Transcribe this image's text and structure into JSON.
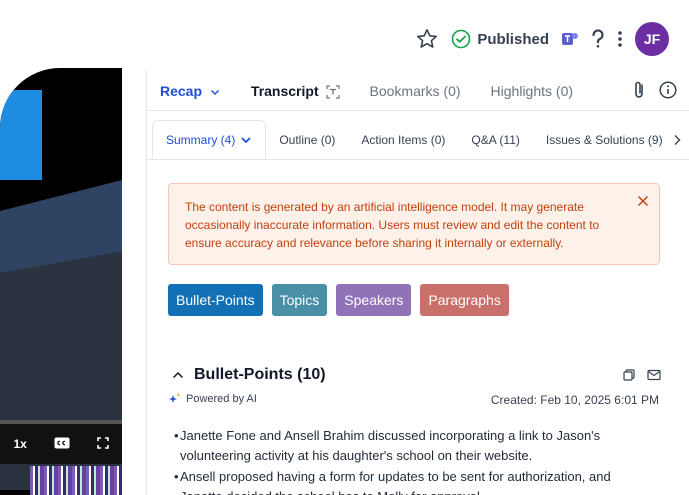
{
  "header": {
    "status_label": "Published",
    "avatar_initials": "JF"
  },
  "video": {
    "speed_label": "1x"
  },
  "top_tabs": [
    {
      "label": "Recap"
    },
    {
      "label": "Transcript"
    },
    {
      "label": "Bookmarks (0)"
    },
    {
      "label": "Highlights (0)"
    }
  ],
  "sub_tabs": [
    {
      "label": "Summary (4)"
    },
    {
      "label": "Outline (0)"
    },
    {
      "label": "Action Items (0)"
    },
    {
      "label": "Q&A (11)"
    },
    {
      "label": "Issues & Solutions (9)"
    }
  ],
  "notice": {
    "text": "The content is generated by an artificial intelligence model. It may generate occasionally inaccurate information. Users must review and edit the content to ensure accuracy and relevance before sharing it internally or externally."
  },
  "chips": [
    {
      "label": "Bullet-Points"
    },
    {
      "label": "Topics"
    },
    {
      "label": "Speakers"
    },
    {
      "label": "Paragraphs"
    }
  ],
  "section": {
    "title": "Bullet-Points (10)",
    "powered_by": "Powered by AI",
    "created": "Created: Feb 10, 2025 6:01 PM"
  },
  "bullets": [
    "Janette Fone and Ansell Brahim discussed incorporating a link to Jason's volunteering activity at his daughter's school on their website.",
    "Ansell proposed having a form for updates to be sent for authorization, and Janette decided the school has to Molly for approval."
  ],
  "colors": {
    "accent": "#1d4ed8",
    "avatar": "#6b2fa3",
    "notice_bg": "#fdf1ea",
    "notice_text": "#c2410c"
  }
}
